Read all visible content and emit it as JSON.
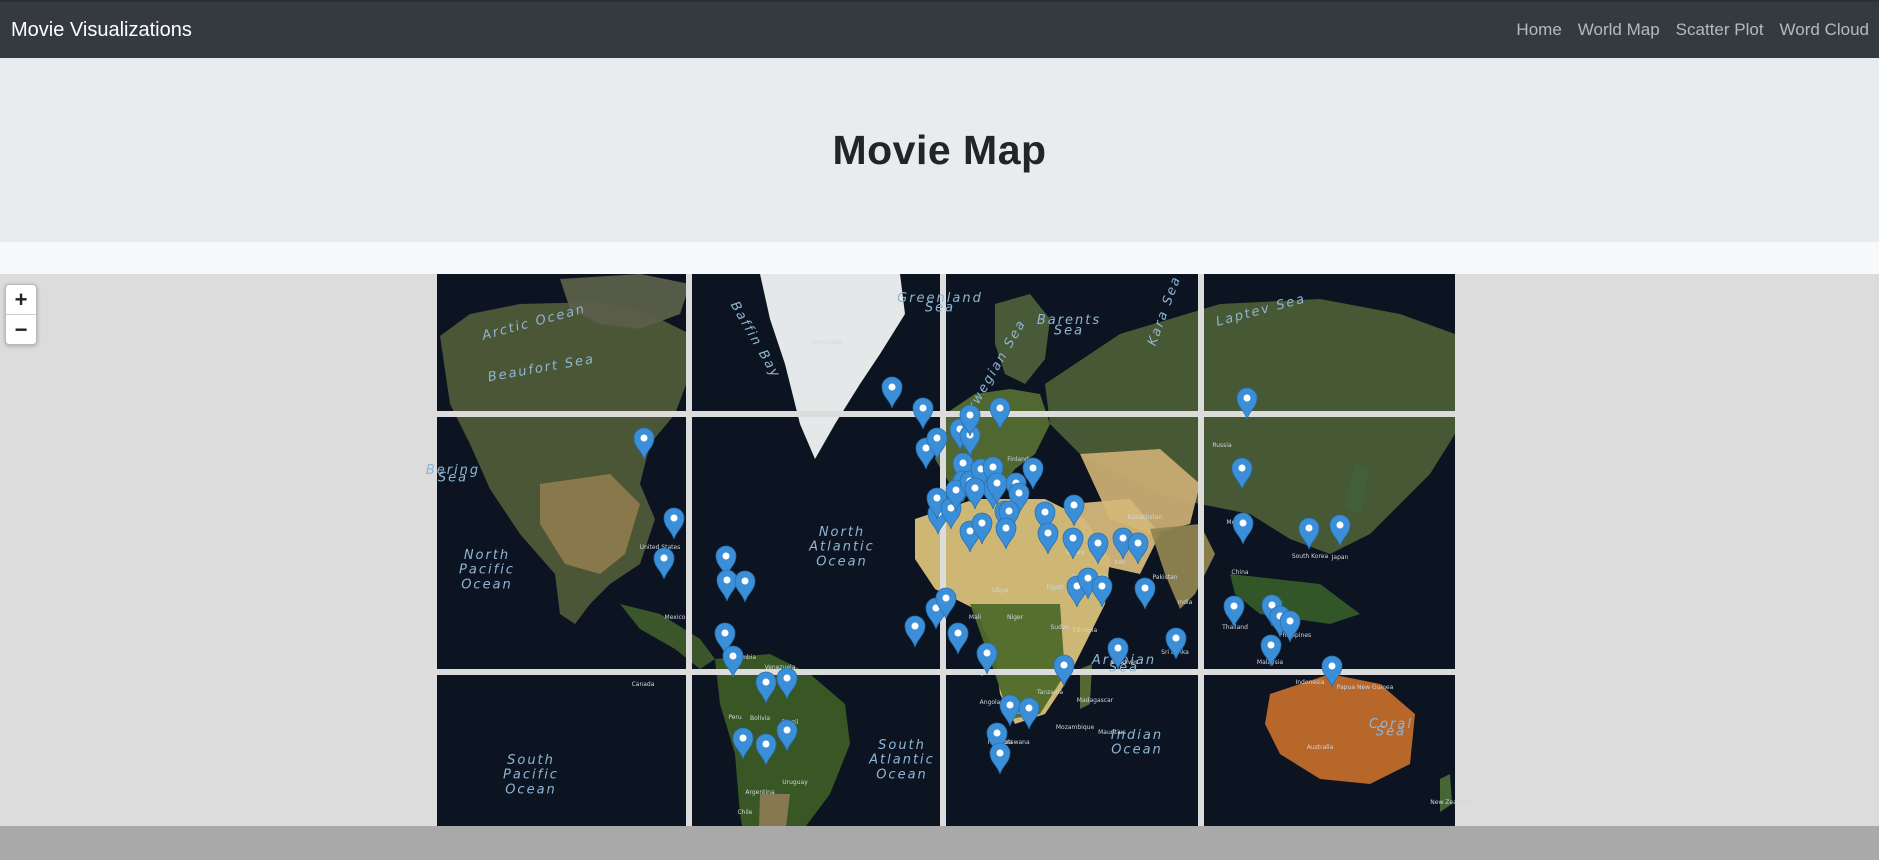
{
  "nav": {
    "brand": "Movie Visualizations",
    "links": [
      "Home",
      "World Map",
      "Scatter Plot",
      "Word Cloud"
    ]
  },
  "header": {
    "title": "Movie Map"
  },
  "zoom": {
    "in": "+",
    "out": "−"
  },
  "map": {
    "basemap": "satellite",
    "ocean_labels": [
      {
        "lines": [
          "Arctic Ocean"
        ]
      },
      {
        "lines": [
          "North",
          "Pacific",
          "Ocean"
        ]
      },
      {
        "lines": [
          "North",
          "Atlantic",
          "Ocean"
        ]
      },
      {
        "lines": [
          "South",
          "Pacific",
          "Ocean"
        ]
      },
      {
        "lines": [
          "South",
          "Atlantic",
          "Ocean"
        ]
      },
      {
        "lines": [
          "Indian",
          "Ocean"
        ]
      },
      {
        "lines": [
          "Barents",
          "Sea"
        ]
      },
      {
        "lines": [
          "Greenland",
          "Sea"
        ]
      },
      {
        "lines": [
          "Norwegian Sea"
        ]
      },
      {
        "lines": [
          "Laptev Sea"
        ]
      },
      {
        "lines": [
          "Bering",
          "Sea"
        ]
      },
      {
        "lines": [
          "Arabian",
          "Sea"
        ]
      },
      {
        "lines": [
          "Coral",
          "Sea"
        ]
      },
      {
        "lines": [
          "Kara Sea"
        ]
      },
      {
        "lines": [
          "Beaufort Sea"
        ]
      },
      {
        "lines": [
          "Baffin Bay"
        ]
      }
    ],
    "place_labels": [
      "Greenland",
      "Canada",
      "United States",
      "Mexico",
      "Brazil",
      "Bolivia",
      "Peru",
      "Venezuela",
      "Colombia",
      "Argentina",
      "Chile",
      "Uruguay",
      "Libya",
      "Egypt",
      "Sudan",
      "Mali",
      "Niger",
      "Nigeria",
      "Ethiopia",
      "Kenya",
      "Tanzania",
      "Zambia",
      "Namibia",
      "Botswana",
      "Angola",
      "Mozambique",
      "Mauritius",
      "Madagascar",
      "Russia",
      "Kazakhstan",
      "Mongolia",
      "China",
      "India",
      "Pakistan",
      "Iran",
      "Saudi Arabia",
      "Turkey",
      "Finland",
      "South Korea",
      "Japan",
      "Thailand",
      "Philippines",
      "Indonesia",
      "Malaysia",
      "Papua New Guinea",
      "Sri Lanka",
      "Maldives",
      "Australia",
      "New Zealand",
      "Falkland Islands (Malvinas)"
    ],
    "marker_color": "#3b8fd8",
    "marker_count": 75
  }
}
